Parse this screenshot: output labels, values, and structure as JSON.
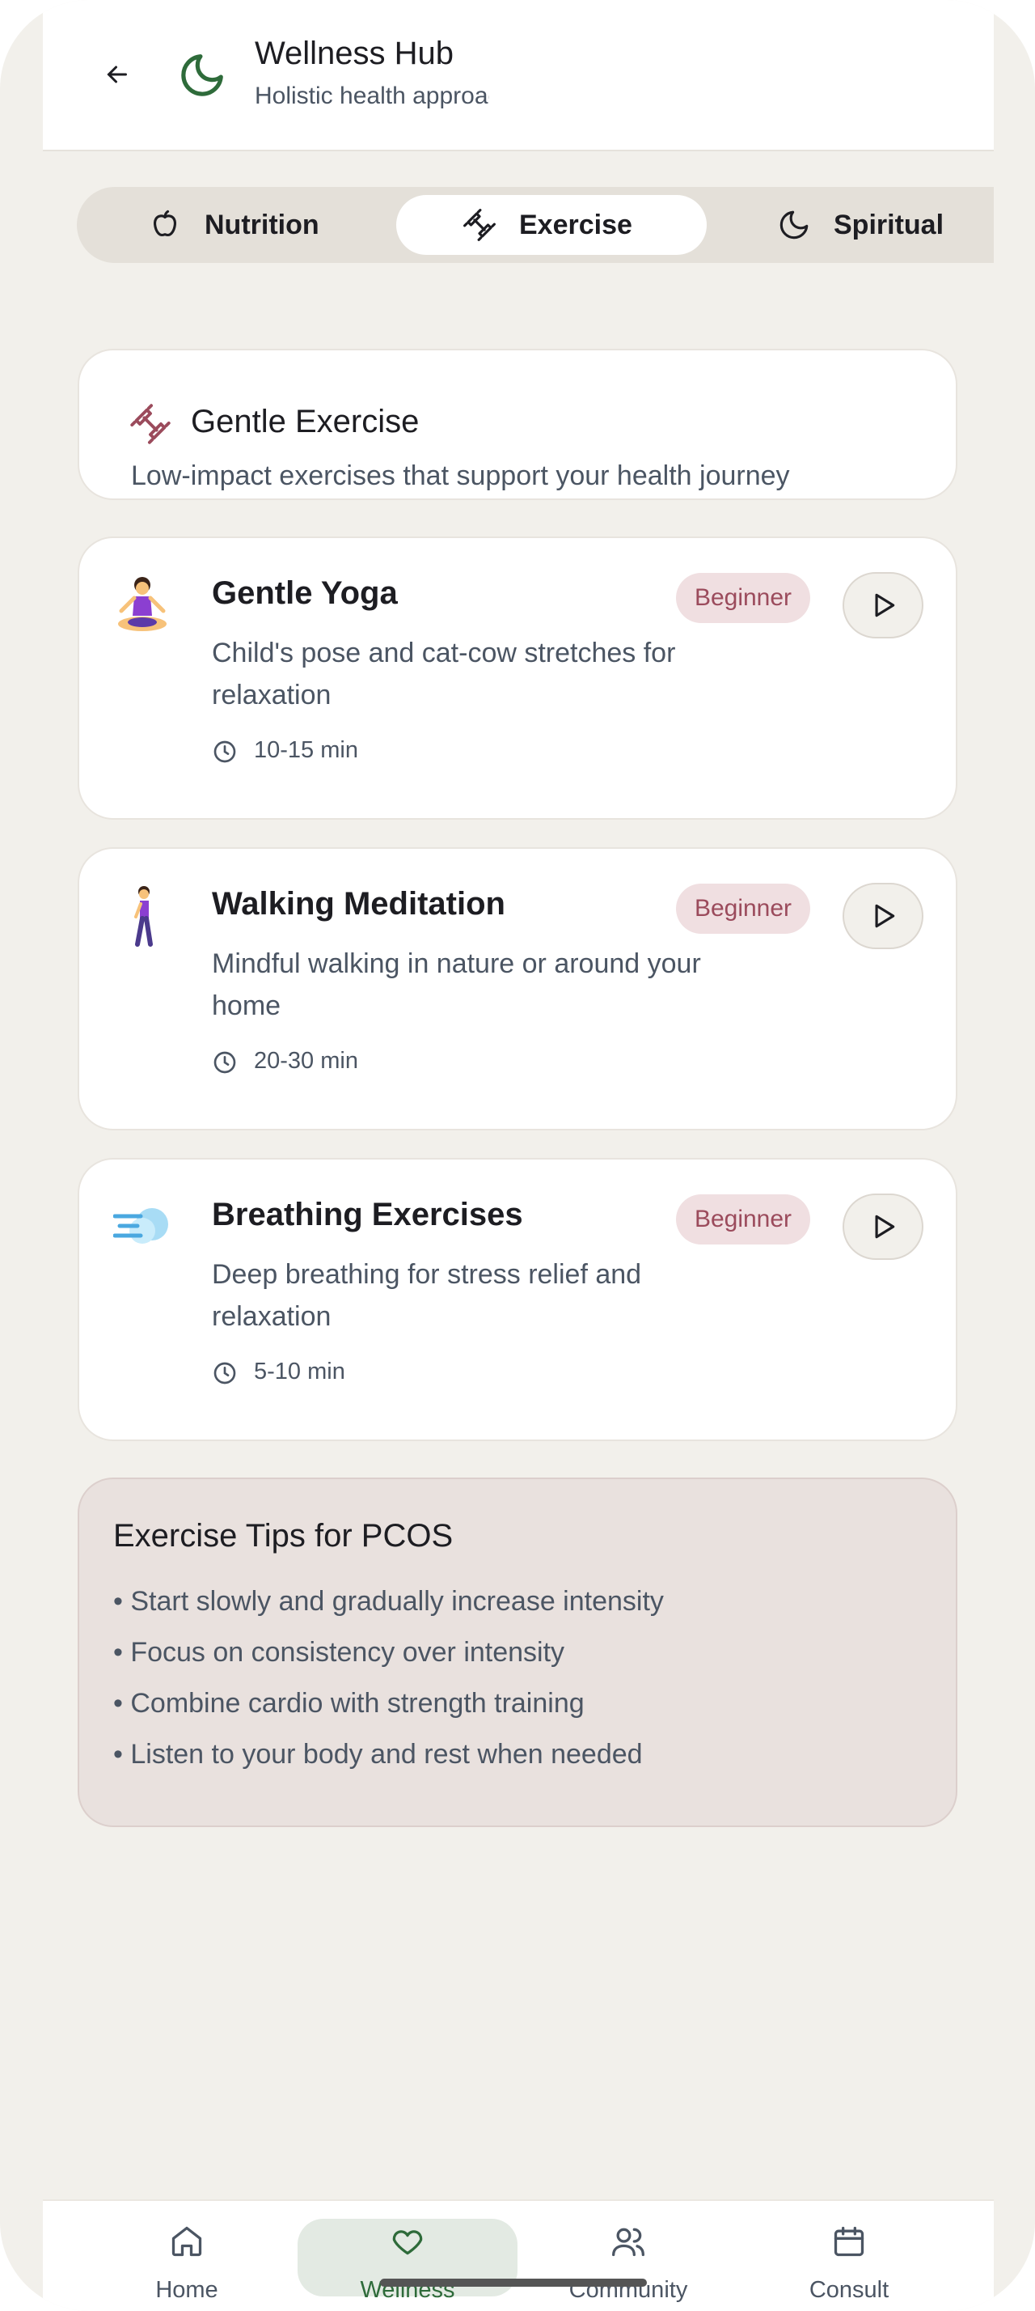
{
  "header": {
    "title": "Wellness Hub",
    "subtitle": "Holistic health approach"
  },
  "tabs": [
    {
      "label": "Nutrition",
      "icon": "apple-icon"
    },
    {
      "label": "Exercise",
      "icon": "dumbbell-icon",
      "active": true
    },
    {
      "label": "Spiritual",
      "icon": "moon-icon"
    }
  ],
  "section": {
    "title": "Gentle Exercise",
    "description": "Low-impact exercises that support your health journey"
  },
  "exercises": [
    {
      "emoji": "person-in-lotus-position",
      "title": "Gentle Yoga",
      "level": "Beginner",
      "description": "Child's pose and cat-cow stretches for relaxation",
      "duration": "10-15 min"
    },
    {
      "emoji": "woman-walking",
      "title": "Walking Meditation",
      "level": "Beginner",
      "description": "Mindful walking in nature or around your home",
      "duration": "20-30 min"
    },
    {
      "emoji": "dashing-away",
      "title": "Breathing Exercises",
      "level": "Beginner",
      "description": "Deep breathing for stress relief and relaxation",
      "duration": "5-10 min"
    }
  ],
  "tips": {
    "title": "Exercise Tips for PCOS",
    "items": [
      "• Start slowly and gradually increase intensity",
      "• Focus on consistency over intensity",
      "• Combine cardio with strength training",
      "• Listen to your body and rest when needed"
    ]
  },
  "nav": [
    {
      "label": "Home",
      "icon": "home-icon"
    },
    {
      "label": "Wellness",
      "icon": "heart-icon",
      "active": true
    },
    {
      "label": "Community",
      "icon": "users-icon"
    },
    {
      "label": "Consult",
      "icon": "calendar-icon"
    }
  ],
  "colors": {
    "accent_green": "#2e6b3a",
    "badge_text": "#9b4b5c",
    "badge_bg": "#f0dfe1",
    "background": "#f2f0eb"
  }
}
